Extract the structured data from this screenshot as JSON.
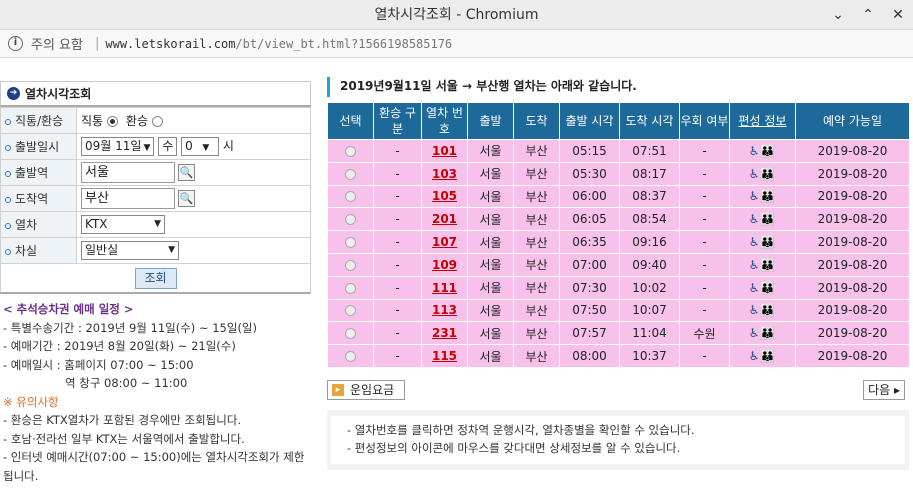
{
  "window": {
    "title": "열차시각조회 - Chromium",
    "min": "⌄",
    "restore": "⌃",
    "close": "✕"
  },
  "address": {
    "warning": "주의 요함",
    "url_host": "www.letskorail.com",
    "url_rest": "/bt/view_bt.html?1566198585176"
  },
  "left": {
    "heading": "열차시각조회",
    "rows": {
      "direct_label": "직통/환승",
      "direct_opt": "직통",
      "transfer_opt": "환승",
      "date_label": "출발일시",
      "date_value": "09월 11일",
      "weekday": "수",
      "hour": "0",
      "hour_unit": "시",
      "from_label": "출발역",
      "from_value": "서울",
      "to_label": "도착역",
      "to_value": "부산",
      "train_label": "열차",
      "train_value": "KTX",
      "class_label": "차실",
      "class_value": "일반실"
    },
    "search_button": "조회",
    "notice": {
      "title": "< 추석승차권 예매 일정 >",
      "l1": "- 특별수송기간 : 2019년 9월 11일(수) ~ 15일(일)",
      "l2": "- 예매기간 : 2019년 8월 20일(화) ~ 21일(수)",
      "l3": "- 예매일시 : 홈페이지 07:00 ~ 15:00",
      "l4": "역 창구  08:00 ~ 11:00",
      "caution_title": "※ 유의사항",
      "c1": "- 환승은 KTX열차가 포함된 경우에만 조회됩니다.",
      "c2": "- 호남·전라선 일부 KTX는 서울역에서 출발합니다.",
      "c3": "- 인터넷 예매시간(07:00 ~ 15:00)에는 열차시각조회가 제한됩니다."
    }
  },
  "right": {
    "heading": "2019년9월11일 서울  →  부산행 열차는 아래와 같습니다.",
    "columns": [
      "선택",
      "환승 구분",
      "열차 번호",
      "출발",
      "도착",
      "출발 시각",
      "도착 시각",
      "우회 여부",
      "편성 정보",
      "예약 가능일"
    ],
    "rows": [
      {
        "transfer": "-",
        "no": "101",
        "from": "서울",
        "to": "부산",
        "dep": "05:15",
        "arr": "07:51",
        "detour": "-",
        "date": "2019-08-20"
      },
      {
        "transfer": "-",
        "no": "103",
        "from": "서울",
        "to": "부산",
        "dep": "05:30",
        "arr": "08:17",
        "detour": "-",
        "date": "2019-08-20"
      },
      {
        "transfer": "-",
        "no": "105",
        "from": "서울",
        "to": "부산",
        "dep": "06:00",
        "arr": "08:37",
        "detour": "-",
        "date": "2019-08-20"
      },
      {
        "transfer": "-",
        "no": "201",
        "from": "서울",
        "to": "부산",
        "dep": "06:05",
        "arr": "08:54",
        "detour": "-",
        "date": "2019-08-20"
      },
      {
        "transfer": "-",
        "no": "107",
        "from": "서울",
        "to": "부산",
        "dep": "06:35",
        "arr": "09:16",
        "detour": "-",
        "date": "2019-08-20"
      },
      {
        "transfer": "-",
        "no": "109",
        "from": "서울",
        "to": "부산",
        "dep": "07:00",
        "arr": "09:40",
        "detour": "-",
        "date": "2019-08-20"
      },
      {
        "transfer": "-",
        "no": "111",
        "from": "서울",
        "to": "부산",
        "dep": "07:30",
        "arr": "10:02",
        "detour": "-",
        "date": "2019-08-20"
      },
      {
        "transfer": "-",
        "no": "113",
        "from": "서울",
        "to": "부산",
        "dep": "07:50",
        "arr": "10:07",
        "detour": "-",
        "date": "2019-08-20"
      },
      {
        "transfer": "-",
        "no": "231",
        "from": "서울",
        "to": "부산",
        "dep": "07:57",
        "arr": "11:04",
        "detour": "수원",
        "date": "2019-08-20"
      },
      {
        "transfer": "-",
        "no": "115",
        "from": "서울",
        "to": "부산",
        "dep": "08:00",
        "arr": "10:37",
        "detour": "-",
        "date": "2019-08-20"
      }
    ],
    "fare_button": "운임요금",
    "next_button": "다음",
    "guide1": "- 열차번호를 클릭하면 정차역 운행시각, 열차종별을 확인할 수 있습니다.",
    "guide2": "- 편성정보의 아이콘에 마우스를 갖다대면 상세정보를 알 수 있습니다."
  },
  "icons": {
    "formation": "wheelchair-family-icons"
  },
  "colors": {
    "header_bg": "#1d6a9a",
    "row_bg": "#f7c1ec",
    "train_no": "#c40000",
    "accent": "#1ea6d8"
  }
}
